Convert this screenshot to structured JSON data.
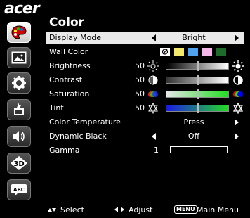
{
  "brand": "acer",
  "page_title": "Color",
  "menu": {
    "display_mode": {
      "label": "Display Mode",
      "value": "Bright"
    },
    "wall_color": {
      "label": "Wall Color",
      "swatches": [
        "#ffffff",
        "#f5e96a",
        "#4fa3ee",
        "#f4b6e8",
        "#1f6b2b"
      ]
    },
    "brightness": {
      "label": "Brightness",
      "value": "50",
      "level": 0.5
    },
    "contrast": {
      "label": "Contrast",
      "value": "50",
      "level": 0.5
    },
    "saturation": {
      "label": "Saturation",
      "value": "50",
      "level": 0.5
    },
    "tint": {
      "label": "Tint",
      "value": "50",
      "level": 0.5
    },
    "color_temperature": {
      "label": "Color Temperature",
      "value": "Press"
    },
    "dynamic_black": {
      "label": "Dynamic Black",
      "value": "Off"
    },
    "gamma": {
      "label": "Gamma",
      "value": "1"
    }
  },
  "sidebar": [
    "palette-icon",
    "picture-icon",
    "gear-icon",
    "power-battery-icon",
    "speaker-icon",
    "3d-icon",
    "abc-subtitle-icon"
  ],
  "footer": {
    "select": "Select",
    "adjust": "Adjust",
    "menu_key": "MENU",
    "main_menu": "Main Menu"
  },
  "colors": {
    "highlight": "#e9e9e9",
    "background": "#000000"
  }
}
